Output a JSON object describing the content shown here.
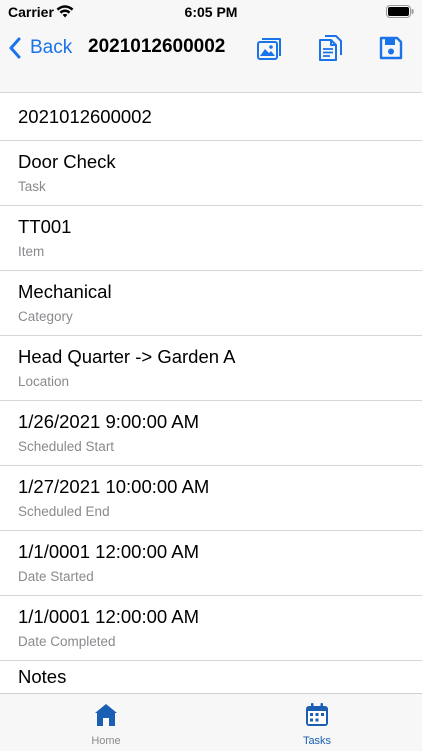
{
  "status_bar": {
    "carrier": "Carrier",
    "time": "6:05 PM"
  },
  "nav": {
    "back_label": "Back",
    "title": "2021012600002",
    "accent_color": "#1a73e8",
    "actions": [
      "photo-gallery-icon",
      "document-icon",
      "save-icon"
    ]
  },
  "details": {
    "task_number": "2021012600002",
    "task": {
      "value": "Door Check",
      "label": "Task"
    },
    "item": {
      "value": "TT001",
      "label": "Item"
    },
    "category": {
      "value": "Mechanical",
      "label": "Category"
    },
    "location": {
      "value": "Head Quarter -> Garden A",
      "label": "Location"
    },
    "scheduled_start": {
      "value": "1/26/2021 9:00:00 AM",
      "label": "Scheduled Start"
    },
    "scheduled_end": {
      "value": "1/27/2021 10:00:00 AM",
      "label": "Scheduled End"
    },
    "date_started": {
      "value": "1/1/0001 12:00:00 AM",
      "label": "Date Started"
    },
    "date_completed": {
      "value": "1/1/0001 12:00:00 AM",
      "label": "Date Completed"
    },
    "notes_label": "Notes"
  },
  "tab_bar": {
    "selected_color": "#1a5fb4",
    "items": [
      {
        "label": "Home",
        "icon": "home-icon",
        "selected": false
      },
      {
        "label": "Tasks",
        "icon": "calendar-icon",
        "selected": true
      }
    ]
  }
}
